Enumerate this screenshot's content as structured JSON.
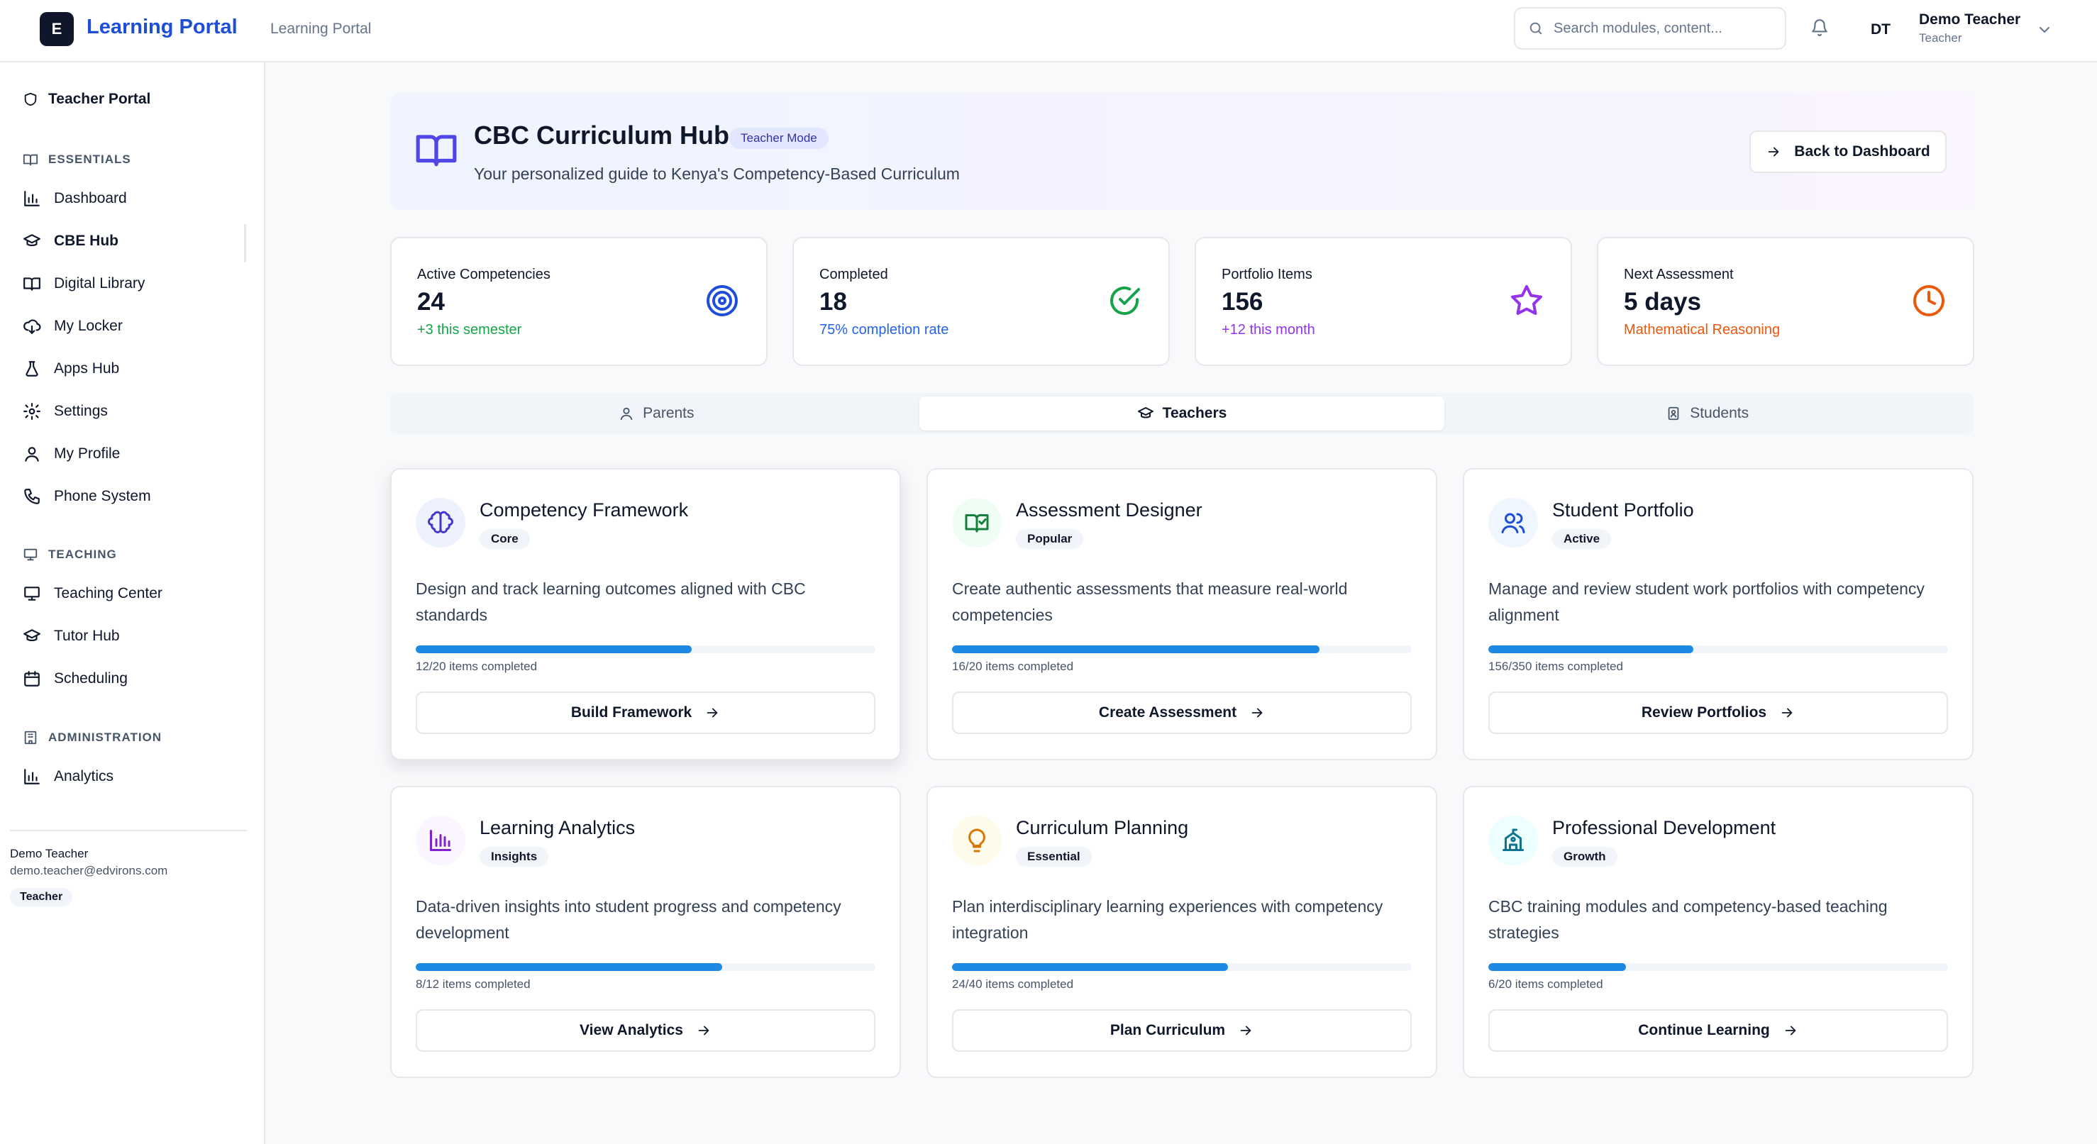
{
  "header": {
    "logo_letter": "E",
    "brand": "Learning Portal",
    "breadcrumb": "Learning Portal",
    "search_placeholder": "Search modules, content...",
    "user_initials": "DT",
    "user_name": "Demo Teacher",
    "user_role": "Teacher"
  },
  "sidebar": {
    "portal_label": "Teacher Portal",
    "sections": {
      "essentials": "ESSENTIALS",
      "teaching": "TEACHING",
      "administration": "ADMINISTRATION"
    },
    "items": {
      "dashboard": "Dashboard",
      "cbe_hub": "CBE Hub",
      "digital_library": "Digital Library",
      "my_locker": "My Locker",
      "apps_hub": "Apps Hub",
      "settings": "Settings",
      "my_profile": "My Profile",
      "phone_system": "Phone System",
      "teaching_center": "Teaching Center",
      "tutor_hub": "Tutor Hub",
      "scheduling": "Scheduling",
      "analytics": "Analytics"
    },
    "footer": {
      "name": "Demo Teacher",
      "email": "demo.teacher@edvirons.com",
      "role": "Teacher"
    }
  },
  "hero": {
    "title": "CBC Curriculum Hub",
    "badge": "Teacher Mode",
    "subtitle": "Your personalized guide to Kenya's Competency-Based Curriculum",
    "back_label": "Back to Dashboard"
  },
  "stats": [
    {
      "label": "Active Competencies",
      "value": "24",
      "note": "+3 this semester",
      "note_color": "#16a34a",
      "icon": "target-icon",
      "icon_color": "#1d4ed8"
    },
    {
      "label": "Completed",
      "value": "18",
      "note": "75% completion rate",
      "note_color": "#2563eb",
      "icon": "check-circle-icon",
      "icon_color": "#16a34a"
    },
    {
      "label": "Portfolio Items",
      "value": "156",
      "note": "+12 this month",
      "note_color": "#9333ea",
      "icon": "star-icon",
      "icon_color": "#9333ea"
    },
    {
      "label": "Next Assessment",
      "value": "5 days",
      "note": "Mathematical Reasoning",
      "note_color": "#ea580c",
      "icon": "clock-icon",
      "icon_color": "#ea580c"
    }
  ],
  "tabs": [
    {
      "label": "Parents",
      "icon": "user-icon",
      "active": false
    },
    {
      "label": "Teachers",
      "icon": "graduation-cap-icon",
      "active": true
    },
    {
      "label": "Students",
      "icon": "id-badge-icon",
      "active": false
    }
  ],
  "cards": [
    {
      "title": "Competency Framework",
      "badge": "Core",
      "desc": "Design and track learning outcomes aligned with CBC standards",
      "done": 12,
      "total": 20,
      "progress_text": "12/20 items completed",
      "button": "Build Framework",
      "icon": "brain-icon",
      "icon_color": "#4338ca",
      "icon_bg": "#eef2ff"
    },
    {
      "title": "Assessment Designer",
      "badge": "Popular",
      "desc": "Create authentic assessments that measure real-world competencies",
      "done": 16,
      "total": 20,
      "progress_text": "16/20 items completed",
      "button": "Create Assessment",
      "icon": "book-check-icon",
      "icon_color": "#15803d",
      "icon_bg": "#f0fdf4"
    },
    {
      "title": "Student Portfolio",
      "badge": "Active",
      "desc": "Manage and review student work portfolios with competency alignment",
      "done": 156,
      "total": 350,
      "progress_text": "156/350 items completed",
      "button": "Review Portfolios",
      "icon": "users-icon",
      "icon_color": "#1d4ed8",
      "icon_bg": "#eff6ff"
    },
    {
      "title": "Learning Analytics",
      "badge": "Insights",
      "desc": "Data-driven insights into student progress and competency development",
      "done": 8,
      "total": 12,
      "progress_text": "8/12 items completed",
      "button": "View Analytics",
      "icon": "bar-chart-icon",
      "icon_color": "#7e22ce",
      "icon_bg": "#faf5ff"
    },
    {
      "title": "Curriculum Planning",
      "badge": "Essential",
      "desc": "Plan interdisciplinary learning experiences with competency integration",
      "done": 24,
      "total": 40,
      "progress_text": "24/40 items completed",
      "button": "Plan Curriculum",
      "icon": "lightbulb-icon",
      "icon_color": "#d97706",
      "icon_bg": "#fffbeb"
    },
    {
      "title": "Professional Development",
      "badge": "Growth",
      "desc": "CBC training modules and competency-based teaching strategies",
      "done": 6,
      "total": 20,
      "progress_text": "6/20 items completed",
      "button": "Continue Learning",
      "icon": "school-icon",
      "icon_color": "#0e7490",
      "icon_bg": "#ecfeff"
    }
  ]
}
